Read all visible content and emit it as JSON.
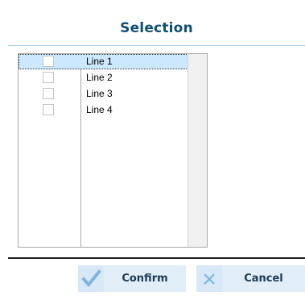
{
  "dialog": {
    "title": "Selection"
  },
  "list": {
    "items": [
      {
        "label": "Line 1",
        "checked": false,
        "selected": true
      },
      {
        "label": "Line 2",
        "checked": false,
        "selected": false
      },
      {
        "label": "Line 3",
        "checked": false,
        "selected": false
      },
      {
        "label": "Line 4",
        "checked": false,
        "selected": false
      }
    ]
  },
  "buttons": {
    "confirm_label": "Confirm",
    "confirm_icon": "checkmark-icon",
    "cancel_label": "Cancel",
    "cancel_icon": "close-icon"
  },
  "colors": {
    "title": "#0e4f78",
    "selection_highlight": "#cce8ff",
    "button_background": "#e1edf7",
    "icon_glyph": "#7fb5e0"
  }
}
